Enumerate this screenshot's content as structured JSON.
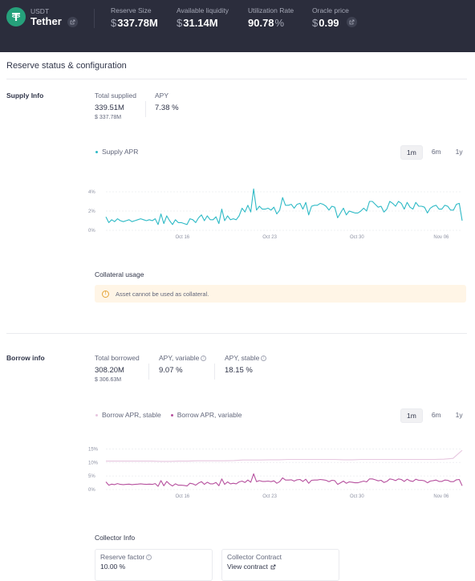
{
  "header": {
    "asset_symbol": "USDT",
    "asset_name": "Tether",
    "stats": [
      {
        "label": "Reserve Size",
        "prefix": "$",
        "value": "337.78M",
        "suffix": ""
      },
      {
        "label": "Available liquidity",
        "prefix": "$",
        "value": "31.14M",
        "suffix": ""
      },
      {
        "label": "Utilization Rate",
        "prefix": "",
        "value": "90.78",
        "suffix": "%"
      },
      {
        "label": "Oracle price",
        "prefix": "$",
        "value": "0.99",
        "suffix": ""
      }
    ],
    "colors": {
      "background": "#2b2d3c",
      "logo": "#26a17b"
    }
  },
  "page": {
    "title": "Reserve status & configuration"
  },
  "supply": {
    "label": "Supply Info",
    "total_supplied_label": "Total supplied",
    "total_supplied": "339.51M",
    "total_supplied_usd": "$ 337.78M",
    "apy_label": "APY",
    "apy": "7.38 %",
    "legend": [
      {
        "name": "Supply APR",
        "color": "#2ebac6"
      }
    ],
    "range_options": [
      "1m",
      "6m",
      "1y"
    ],
    "range_selected": "1m",
    "collateral_title": "Collateral usage",
    "collateral_warning": "Asset cannot be used as collateral."
  },
  "borrow": {
    "label": "Borrow info",
    "total_borrowed_label": "Total borrowed",
    "total_borrowed": "308.20M",
    "total_borrowed_usd": "$ 306.63M",
    "apy_variable_label": "APY, variable",
    "apy_variable": "9.07 %",
    "apy_stable_label": "APY, stable",
    "apy_stable": "18.15 %",
    "legend": [
      {
        "name": "Borrow APR, stable",
        "color": "#e7c6df"
      },
      {
        "name": "Borrow APR, variable",
        "color": "#b6509e"
      }
    ],
    "range_options": [
      "1m",
      "6m",
      "1y"
    ],
    "range_selected": "1m"
  },
  "collector": {
    "title": "Collector Info",
    "reserve_factor_label": "Reserve factor",
    "reserve_factor": "10.00 %",
    "contract_label": "Collector Contract",
    "contract_link": "View contract"
  },
  "chart_data": [
    {
      "type": "line",
      "title": "Supply APR",
      "x_ticks": [
        "Oct 16",
        "Oct 23",
        "Oct 30",
        "Nov 06"
      ],
      "y_ticks": [
        "0%",
        "2%",
        "4%"
      ],
      "ylim": [
        0,
        4.5
      ],
      "grid": true,
      "series": [
        {
          "name": "Supply APR",
          "color": "#2ebac6",
          "values": [
            1.4,
            0.8,
            1.1,
            0.9,
            1.2,
            1.0,
            0.9,
            1.0,
            1.1,
            0.9,
            1.0,
            1.1,
            1.2,
            1.1,
            1.0,
            1.1,
            1.0,
            1.2,
            0.6,
            1.7,
            0.7,
            1.5,
            1.0,
            0.6,
            1.1,
            0.8,
            0.8,
            0.7,
            0.6,
            1.2,
            1.1,
            0.8,
            1.3,
            1.6,
            1.0,
            1.5,
            1.1,
            1.1,
            1.4,
            0.7,
            2.2,
            1.0,
            1.5,
            1.1,
            1.2,
            1.1,
            1.5,
            2.3,
            1.9,
            2.6,
            1.9,
            4.3,
            2.1,
            2.5,
            2.2,
            2.2,
            2.3,
            2.1,
            2.4,
            1.7,
            2.1,
            3.4,
            2.6,
            2.6,
            2.7,
            2.3,
            2.7,
            2.8,
            2.2,
            2.9,
            1.6,
            2.5,
            2.6,
            2.6,
            2.8,
            2.7,
            2.5,
            2.1,
            2.5,
            2.4,
            1.3,
            1.8,
            2.3,
            1.6,
            2.0,
            1.9,
            1.8,
            1.8,
            2.0,
            2.3,
            2.0,
            3.0,
            3.0,
            2.7,
            2.4,
            2.5,
            1.9,
            2.2,
            3.0,
            2.8,
            2.5,
            3.0,
            2.8,
            2.2,
            2.9,
            2.4,
            2.2,
            2.9,
            2.5,
            2.5,
            2.4,
            1.8,
            2.3,
            2.5,
            2.6,
            2.2,
            2.2,
            2.6,
            2.5,
            2.1,
            2.1,
            2.7,
            2.8,
            1.0
          ]
        }
      ]
    },
    {
      "type": "line",
      "title": "Borrow APR",
      "x_ticks": [
        "Oct 16",
        "Oct 23",
        "Oct 30",
        "Nov 06"
      ],
      "y_ticks": [
        "0%",
        "5%",
        "10%",
        "15%"
      ],
      "ylim": [
        0,
        16
      ],
      "grid": true,
      "series": [
        {
          "name": "Borrow APR, stable",
          "color": "#e7c6df",
          "values": [
            10.5,
            10.5,
            10.5,
            10.5,
            10.5,
            10.5,
            10.4,
            10.4,
            10.5,
            10.5,
            10.6,
            10.6,
            10.6,
            10.6,
            10.7,
            10.9,
            10.9,
            10.9,
            11.0,
            11.0,
            11.1,
            11.1,
            11.1,
            11.1,
            11.1,
            11.1,
            11.0,
            11.0,
            11.1,
            11.1,
            11.1,
            11.1,
            11.1,
            11.1,
            11.1,
            11.1,
            11.1,
            11.2,
            11.5,
            14.5
          ]
        },
        {
          "name": "Borrow APR, variable",
          "color": "#b6509e",
          "values": [
            2.8,
            1.6,
            2.0,
            1.8,
            2.2,
            1.9,
            1.8,
            1.9,
            2.0,
            1.8,
            1.9,
            2.0,
            2.1,
            2.0,
            1.9,
            2.0,
            1.9,
            2.2,
            1.2,
            3.3,
            1.4,
            3.0,
            2.0,
            1.3,
            2.1,
            1.6,
            1.6,
            1.5,
            1.3,
            2.3,
            2.1,
            1.6,
            2.4,
            2.9,
            1.9,
            2.7,
            2.1,
            2.1,
            2.6,
            1.4,
            3.9,
            1.9,
            2.8,
            2.1,
            2.3,
            2.1,
            2.8,
            3.1,
            2.6,
            3.5,
            2.7,
            5.8,
            2.9,
            3.3,
            3.0,
            3.0,
            3.1,
            2.9,
            3.2,
            2.3,
            2.9,
            4.3,
            3.5,
            3.5,
            3.6,
            3.1,
            3.6,
            3.7,
            3.0,
            3.8,
            2.3,
            3.4,
            3.5,
            3.5,
            3.7,
            3.6,
            3.4,
            2.9,
            3.4,
            3.3,
            1.9,
            2.5,
            3.1,
            2.3,
            2.8,
            2.7,
            2.5,
            2.5,
            2.8,
            3.1,
            2.8,
            3.9,
            3.9,
            3.6,
            3.2,
            3.4,
            2.6,
            3.0,
            3.9,
            3.7,
            3.3,
            3.9,
            3.7,
            3.0,
            3.8,
            3.2,
            3.0,
            3.8,
            3.4,
            3.4,
            3.2,
            2.5,
            3.1,
            3.3,
            3.5,
            3.0,
            3.0,
            3.5,
            3.4,
            2.9,
            2.9,
            3.6,
            3.7,
            1.4
          ]
        }
      ]
    }
  ]
}
